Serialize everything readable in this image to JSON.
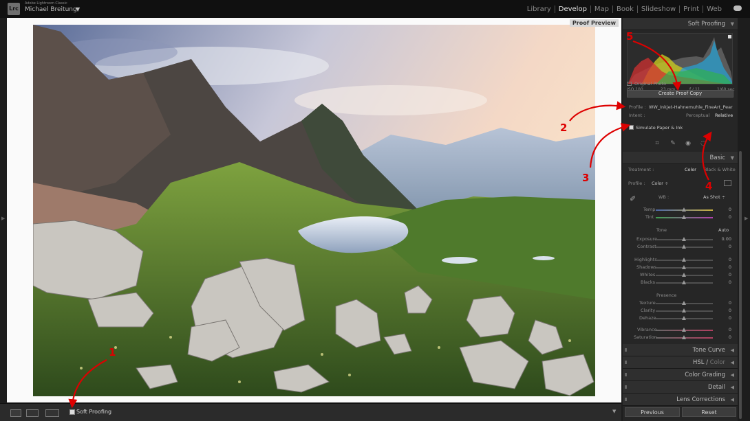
{
  "app": {
    "product_name": "Adobe Lightroom Classic",
    "logo_text": "Lrc",
    "user_name": "Michael Breitung",
    "user_caret": "▼"
  },
  "modules": {
    "items": [
      "Library",
      "Develop",
      "Map",
      "Book",
      "Slideshow",
      "Print",
      "Web"
    ],
    "active": "Develop"
  },
  "canvas": {
    "badge": "Proof Preview"
  },
  "toolbar": {
    "soft_proofing_label": "Soft Proofing",
    "soft_proofing_checked": true
  },
  "soft_proofing": {
    "title": "Soft Proofing",
    "hist_stats": [
      "ISO 100",
      "23 mm",
      "ƒ / 11",
      "1/60 sec"
    ],
    "original_photo_label": "Original Photo",
    "create_proof_copy": "Create Proof Copy",
    "profile_label": "Profile :",
    "profile_value": "WW_Inkjet-Hahnemuhle_FineArt_Pear...",
    "intent_label": "Intent :",
    "intent_options": [
      "Perceptual",
      "Relative"
    ],
    "intent_selected": "Relative",
    "simulate_label": "Simulate Paper & Ink",
    "simulate_checked": true
  },
  "basic": {
    "title": "Basic",
    "treatment_label": "Treatment :",
    "treatment_options": [
      "Color",
      "Black & White"
    ],
    "treatment_selected": "Color",
    "profile_label": "Profile :",
    "profile_value": "Color ÷",
    "wb_label": "WB :",
    "wb_value": "As Shot ÷",
    "temp_label": "Temp",
    "temp_value": "0",
    "tint_label": "Tint",
    "tint_value": "0",
    "tone_label": "Tone",
    "auto_label": "Auto",
    "exposure_label": "Exposure",
    "exposure_value": "0.00",
    "contrast_label": "Contrast",
    "contrast_value": "0",
    "highlights_label": "Highlights",
    "highlights_value": "0",
    "shadows_label": "Shadows",
    "shadows_value": "0",
    "whites_label": "Whites",
    "whites_value": "0",
    "blacks_label": "Blacks",
    "blacks_value": "0",
    "presence_label": "Presence",
    "texture_label": "Texture",
    "texture_value": "0",
    "clarity_label": "Clarity",
    "clarity_value": "0",
    "dehaze_label": "Dehaze",
    "dehaze_value": "0",
    "vibrance_label": "Vibrance",
    "vibrance_value": "0",
    "saturation_label": "Saturation",
    "saturation_value": "0"
  },
  "panels": {
    "tone_curve": "Tone Curve",
    "hsl": "HSL",
    "hsl_sep": "/",
    "hsl_color": "Color",
    "color_grading": "Color Grading",
    "detail": "Detail",
    "lens_corrections": "Lens Corrections"
  },
  "footer": {
    "previous": "Previous",
    "reset": "Reset"
  },
  "annotations": [
    "1",
    "2",
    "3",
    "4",
    "5"
  ],
  "colors": {
    "accent_annotation": "#dd0000",
    "panel_bg": "#262626",
    "topbar_bg": "#101010"
  }
}
